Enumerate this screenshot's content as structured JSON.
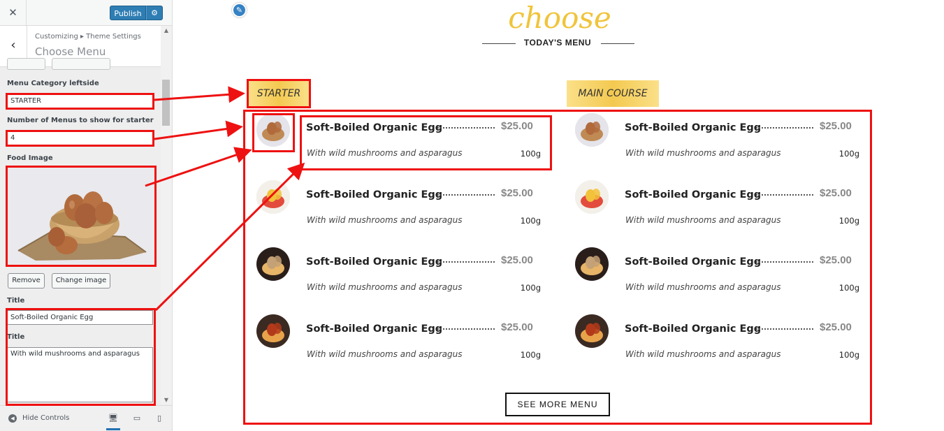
{
  "customizer": {
    "close_icon": "close-icon",
    "publish_label": "Publish",
    "gear_icon": "gear-icon",
    "breadcrumb": "Customizing ▸ Theme Settings",
    "section_title": "Choose Menu",
    "fields": {
      "menu_category_label": "Menu Category leftside",
      "menu_category_value": "STARTER",
      "num_menus_label": "Number of Menus to show for starter",
      "num_menus_value": "4",
      "food_image_label": "Food Image",
      "remove_label": "Remove",
      "change_image_label": "Change image",
      "title_label": "Title",
      "title_value": "Soft-Boiled Organic Egg",
      "desc_label": "Title",
      "desc_value": "With wild mushrooms and asparagus"
    },
    "hide_controls_label": "Hide Controls",
    "devices": [
      "desktop-icon",
      "tablet-icon",
      "mobile-icon"
    ]
  },
  "preview": {
    "heading": "choose",
    "subheading": "TODAY'S MENU",
    "categories": [
      "STARTER",
      "MAIN COURSE"
    ],
    "left_items": [
      {
        "title": "Soft-Boiled Organic Egg",
        "price": "$25.00",
        "desc": "With wild mushrooms and asparagus",
        "weight": "100g",
        "image": "egg-bowl"
      },
      {
        "title": "Soft-Boiled Organic Egg",
        "price": "$25.00",
        "desc": "With wild mushrooms and asparagus",
        "weight": "100g",
        "image": "omelette-plate"
      },
      {
        "title": "Soft-Boiled Organic Egg",
        "price": "$25.00",
        "desc": "With wild mushrooms and asparagus",
        "weight": "100g",
        "image": "pastry-plate"
      },
      {
        "title": "Soft-Boiled Organic Egg",
        "price": "$25.00",
        "desc": "With wild mushrooms and asparagus",
        "weight": "100g",
        "image": "tea-pastry"
      }
    ],
    "right_items": [
      {
        "title": "Soft-Boiled Organic Egg",
        "price": "$25.00",
        "desc": "With wild mushrooms and asparagus",
        "weight": "100g",
        "image": "egg-bowl"
      },
      {
        "title": "Soft-Boiled Organic Egg",
        "price": "$25.00",
        "desc": "With wild mushrooms and asparagus",
        "weight": "100g",
        "image": "omelette-plate"
      },
      {
        "title": "Soft-Boiled Organic Egg",
        "price": "$25.00",
        "desc": "With wild mushrooms and asparagus",
        "weight": "100g",
        "image": "pastry-plate"
      },
      {
        "title": "Soft-Boiled Organic Egg",
        "price": "$25.00",
        "desc": "With wild mushrooms and asparagus",
        "weight": "100g",
        "image": "tea-pastry"
      }
    ],
    "see_more_label": "SEE MORE MENU"
  },
  "colors": {
    "heading": "#f0c43a",
    "category_gold": "#f3c950",
    "publish_blue": "#2e7db3",
    "annotation_red": "#ee1111"
  }
}
